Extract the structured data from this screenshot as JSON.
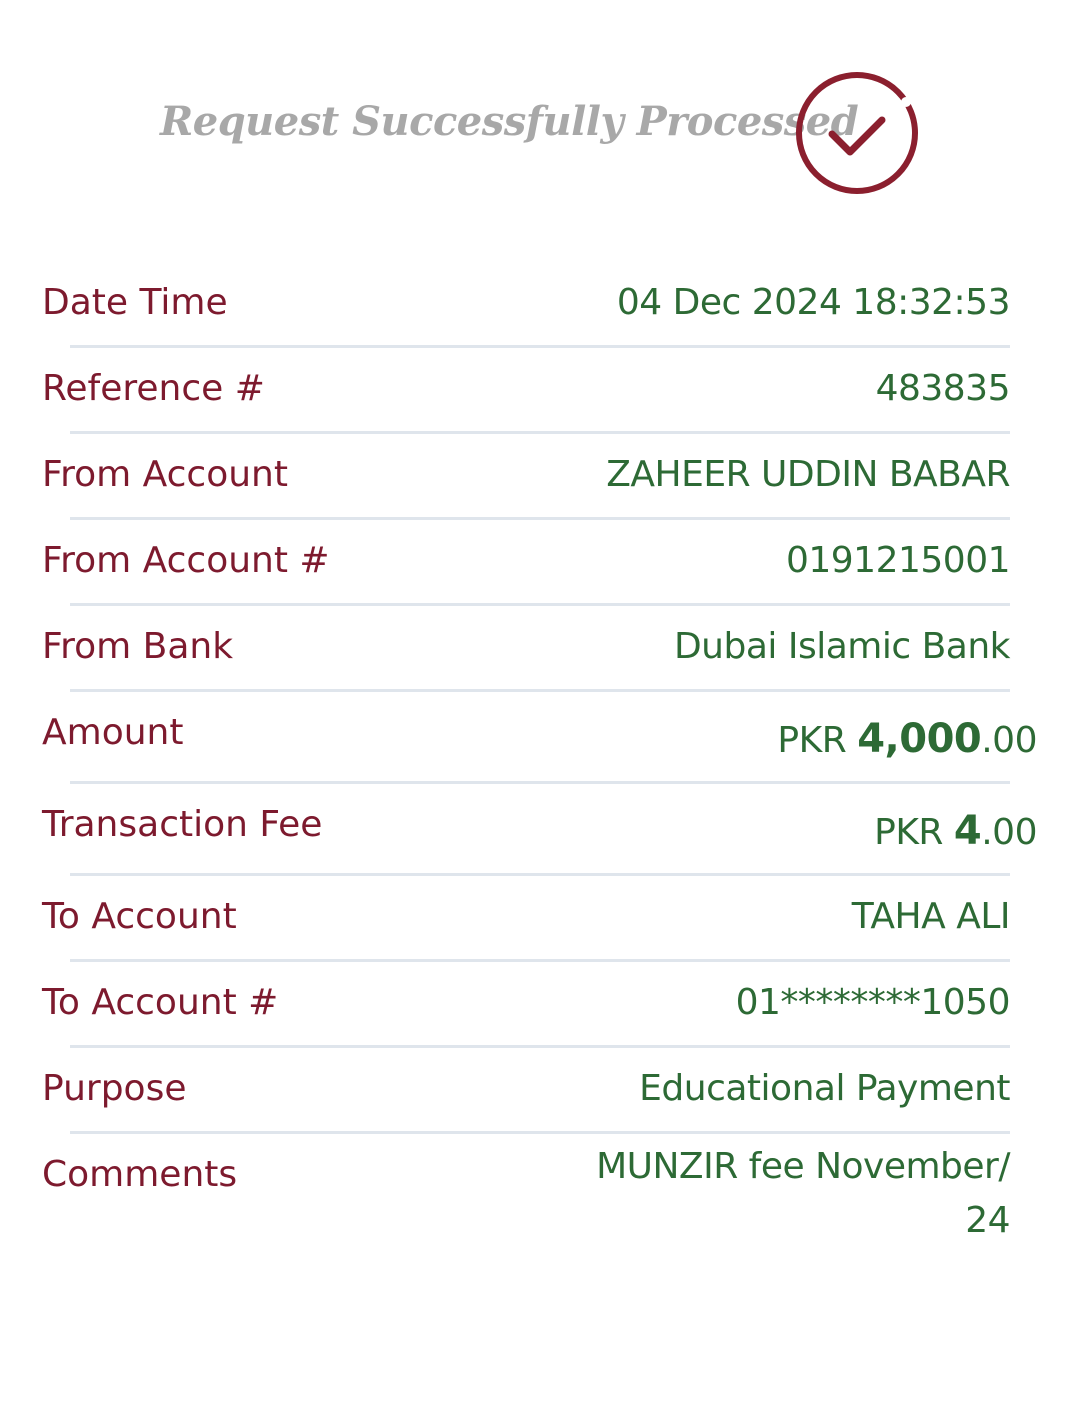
{
  "header": {
    "title": "Request Successfully Processed",
    "icon": "check-circle-icon",
    "icon_color": "#8b1f2e"
  },
  "colors": {
    "label": "#7d1a2e",
    "value": "#2d6a35",
    "divider": "#dfe5ec"
  },
  "details": {
    "date_time": {
      "label": "Date Time",
      "value": "04 Dec 2024 18:32:53"
    },
    "reference": {
      "label": "Reference #",
      "value": "483835"
    },
    "from_account": {
      "label": "From Account",
      "value": "ZAHEER UDDIN BABAR"
    },
    "from_account_no": {
      "label": "From Account #",
      "value": "0191215001"
    },
    "from_bank": {
      "label": "From Bank",
      "value": "Dubai Islamic Bank"
    },
    "amount": {
      "label": "Amount",
      "currency": "PKR ",
      "whole": "4,000",
      "decimal": ".00"
    },
    "transaction_fee": {
      "label": "Transaction Fee",
      "currency": "PKR ",
      "whole": "4",
      "decimal": ".00"
    },
    "to_account": {
      "label": "To Account",
      "value": "TAHA ALI"
    },
    "to_account_no": {
      "label": "To Account #",
      "value": "01********1050"
    },
    "purpose": {
      "label": "Purpose",
      "value": "Educational Payment"
    },
    "comments": {
      "label": "Comments",
      "value": "MUNZIR fee November/ 24"
    }
  }
}
